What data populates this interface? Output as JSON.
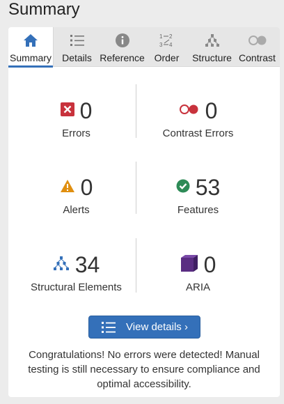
{
  "page": {
    "title": "Summary"
  },
  "tabs": [
    {
      "label": "Summary",
      "icon": "home-icon",
      "active": true
    },
    {
      "label": "Details",
      "icon": "list-icon"
    },
    {
      "label": "Reference",
      "icon": "info-icon"
    },
    {
      "label": "Order",
      "icon": "order-icon"
    },
    {
      "label": "Structure",
      "icon": "hierarchy-icon"
    },
    {
      "label": "Contrast",
      "icon": "contrast-icon"
    }
  ],
  "stats": {
    "errors": {
      "value": "0",
      "label": "Errors",
      "icon": "error-icon",
      "color": "#c8323c"
    },
    "contrast_errors": {
      "value": "0",
      "label": "Contrast Errors",
      "icon": "contrast-error-icon",
      "color": "#c8323c"
    },
    "alerts": {
      "value": "0",
      "label": "Alerts",
      "icon": "alert-icon",
      "color": "#e08f10"
    },
    "features": {
      "value": "53",
      "label": "Features",
      "icon": "check-icon",
      "color": "#2e8b57"
    },
    "structural": {
      "value": "34",
      "label": "Structural Elements",
      "icon": "hierarchy-icon",
      "color": "#3470b9"
    },
    "aria": {
      "value": "0",
      "label": "ARIA",
      "icon": "aria-cube-icon",
      "color": "#5a2d82"
    }
  },
  "actions": {
    "view_details_label": "View details ›"
  },
  "message": "Congratulations! No errors were detected! Manual testing is still necessary to ensure compliance and optimal accessibility.",
  "colors": {
    "accent": "#3470b9",
    "background": "#ececec",
    "tabbar": "#e6e6e6"
  }
}
